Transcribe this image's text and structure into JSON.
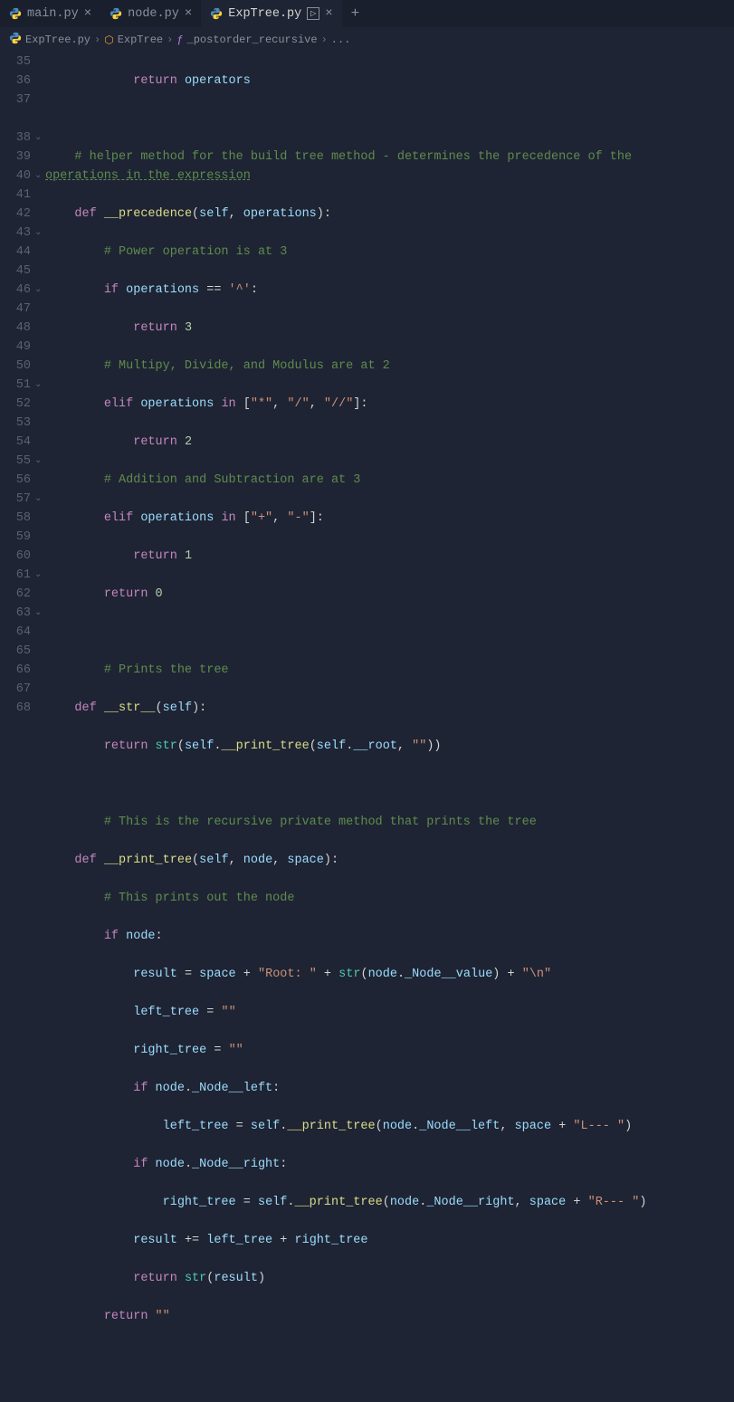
{
  "tabs": [
    {
      "label": "main.py",
      "active": false
    },
    {
      "label": "node.py",
      "active": false
    },
    {
      "label": "ExpTree.py",
      "active": true
    }
  ],
  "breadcrumbs": {
    "file": "ExpTree.py",
    "class": "ExpTree",
    "method": "_postorder_recursive",
    "ellipsis": "..."
  },
  "lines": {
    "start": 35,
    "end": 68,
    "folds": {
      "38": "v",
      "40": "v",
      "43": "v",
      "46": "v",
      "51": "v",
      "55": "v",
      "57": "v",
      "61": "v",
      "63": "v"
    }
  },
  "code": {
    "l35": {
      "return": "return",
      "operators": "operators"
    },
    "l37a": "# helper method for the build tree method - determines the precedence of the ",
    "l37b": "operations in the expression",
    "l38": {
      "def": "def",
      "name": "__precedence",
      "params": "(self, operations):"
    },
    "l39": "# Power operation is at 3",
    "l40": {
      "if": "if",
      "var": "operations",
      "eq": " == ",
      "str": "'^'",
      "colon": ":"
    },
    "l41": {
      "return": "return",
      "val": "3"
    },
    "l42": "# Multipy, Divide, and Modulus are at 2",
    "l43": {
      "elif": "elif",
      "var": "operations",
      "in": " in ",
      "list": "[\"*\", \"/\", \"//\"]",
      "colon": ":"
    },
    "l44": {
      "return": "return",
      "val": "2"
    },
    "l45": "# Addition and Subtraction are at 3",
    "l46": {
      "elif": "elif",
      "var": "operations",
      "in": " in ",
      "list": "[\"+\", \"-\"]",
      "colon": ":"
    },
    "l47": {
      "return": "return",
      "val": "1"
    },
    "l48": {
      "return": "return",
      "val": "0"
    },
    "l50": "# Prints the tree",
    "l51": {
      "def": "def",
      "name": "__str__",
      "params": "(self):"
    },
    "l52": {
      "return": "return",
      "str": "str",
      "self": "self",
      "pt": "__print_tree",
      "root": "__root",
      "empty": "\"\""
    },
    "l54": "# This is the recursive private method that prints the tree",
    "l55": {
      "def": "def",
      "name": "__print_tree",
      "params": "(self, node, space):"
    },
    "l56": "# This prints out the node",
    "l57": {
      "if": "if",
      "node": "node",
      "colon": ":"
    },
    "l58": {
      "result": "result",
      "space": "space",
      "root": "\"Root: \"",
      "str": "str",
      "node": "node",
      "nv": "_Node__value",
      "nl": "\"\\n\""
    },
    "l59": {
      "lt": "left_tree",
      "empty": "\"\""
    },
    "l60": {
      "rt": "right_tree",
      "empty": "\"\""
    },
    "l61": {
      "if": "if",
      "node": "node",
      "nl": "_Node__left",
      "colon": ":"
    },
    "l62": {
      "lt": "left_tree",
      "self": "self",
      "pt": "__print_tree",
      "node": "node",
      "nl": "_Node__left",
      "space": "space",
      "ls": "\"L--- \""
    },
    "l63": {
      "if": "if",
      "node": "node",
      "nr": "_Node__right",
      "colon": ":"
    },
    "l64": {
      "rt": "right_tree",
      "self": "self",
      "pt": "__print_tree",
      "node": "node",
      "nr": "_Node__right",
      "space": "space",
      "rs": "\"R--- \""
    },
    "l65": {
      "result": "result",
      "lt": "left_tree",
      "rt": "right_tree"
    },
    "l66": {
      "return": "return",
      "str": "str",
      "result": "result"
    },
    "l67": {
      "return": "return",
      "empty": "\"\""
    }
  }
}
